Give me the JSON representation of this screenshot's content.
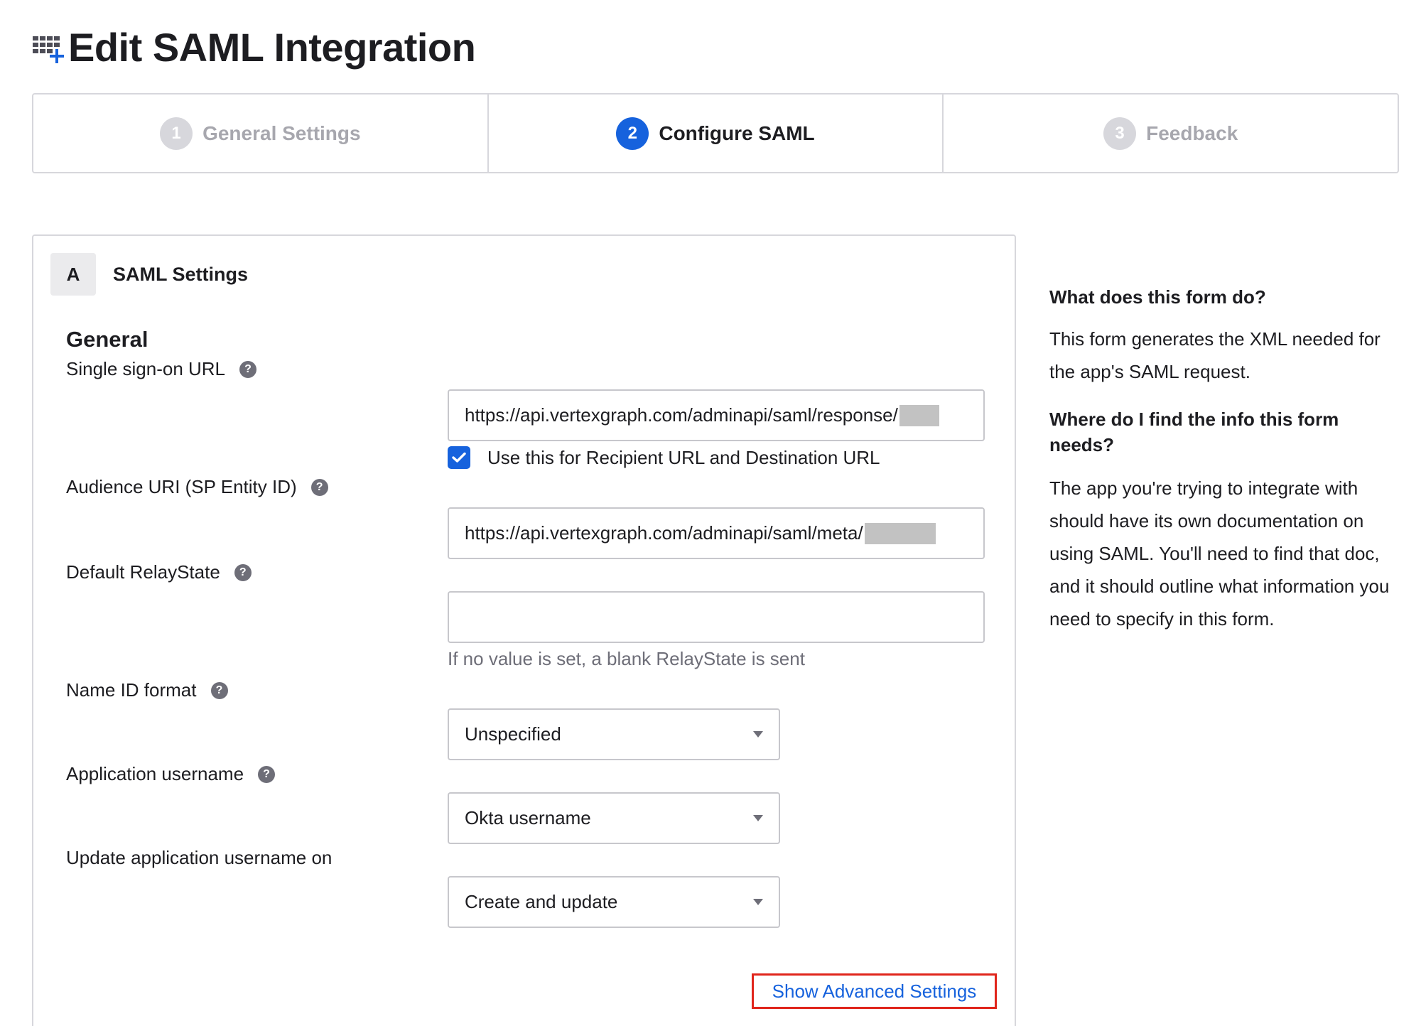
{
  "header": {
    "icon": "grid-plus-icon",
    "title": "Edit SAML Integration"
  },
  "stepper": {
    "steps": [
      {
        "number": "1",
        "label": "General Settings",
        "state": "inactive"
      },
      {
        "number": "2",
        "label": "Configure SAML",
        "state": "active"
      },
      {
        "number": "3",
        "label": "Feedback",
        "state": "inactive"
      }
    ]
  },
  "section": {
    "letter": "A",
    "title": "SAML Settings",
    "group_title": "General",
    "fields": {
      "sso_url": {
        "label": "Single sign-on URL",
        "value": "https://api.vertexgraph.com/adminapi/saml/response/"
      },
      "recipient_checkbox": {
        "label": "Use this for Recipient URL and Destination URL",
        "checked": true
      },
      "audience_uri": {
        "label": "Audience URI (SP Entity ID)",
        "value": "https://api.vertexgraph.com/adminapi/saml/meta/"
      },
      "relay_state": {
        "label": "Default RelayState",
        "value": "",
        "hint": "If no value is set, a blank RelayState is sent"
      },
      "name_id_format": {
        "label": "Name ID format",
        "selected": "Unspecified"
      },
      "app_username": {
        "label": "Application username",
        "selected": "Okta username"
      },
      "update_username_on": {
        "label": "Update application username on",
        "selected": "Create and update"
      }
    },
    "advanced_link": "Show Advanced Settings"
  },
  "aside": {
    "q1": "What does this form do?",
    "a1": "This form generates the XML needed for the app's SAML request.",
    "q2": "Where do I find the info this form needs?",
    "a2": "The app you're trying to integrate with should have its own documentation on using SAML. You'll need to find that doc, and it should outline what information you need to specify in this form."
  },
  "colors": {
    "accent": "#1662dd",
    "highlight_border": "#e0251b",
    "border": "#d7d7dc",
    "muted_text": "#6e6e78",
    "redaction": "#c2c2c2"
  }
}
